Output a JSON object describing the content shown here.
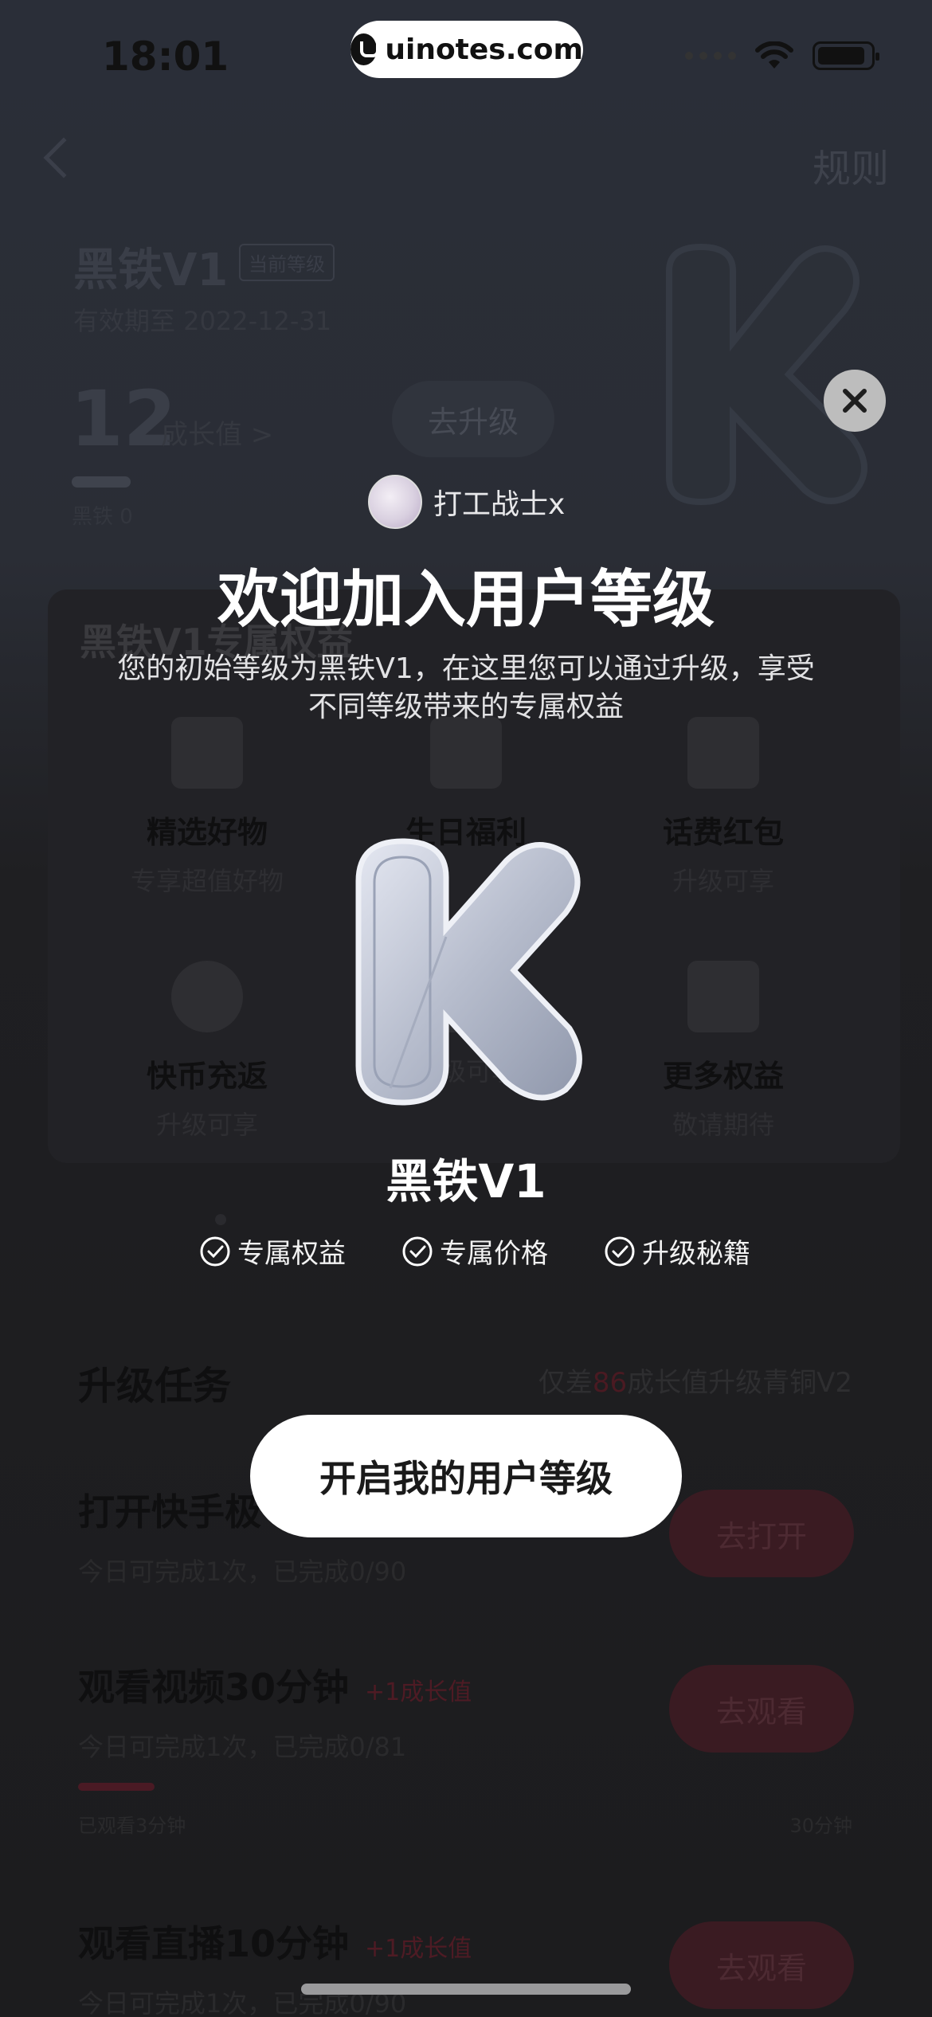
{
  "status_bar": {
    "time": "18:01"
  },
  "watermark": {
    "text": "uinotes.com"
  },
  "header": {
    "rules_label": "规则"
  },
  "level_card": {
    "title": "黑铁V1",
    "current_badge": "当前等级",
    "valid_until": "有效期至 2022-12-31",
    "growth_value": "12",
    "growth_label": "成长值 >",
    "upgrade_button": "去升级",
    "level_label": "黑铁 0"
  },
  "benefits": {
    "title": "黑铁V1专属权益",
    "items": [
      {
        "name": "精选好物",
        "desc": "专享超值好物",
        "icon": "cart-icon"
      },
      {
        "name": "生日福利",
        "desc": "",
        "icon": "cake-icon"
      },
      {
        "name": "话费红包",
        "desc": "升级可享",
        "icon": "phone-icon"
      },
      {
        "name": "快币充返",
        "desc": "升级可享",
        "icon": "coin-icon"
      },
      {
        "name": "",
        "desc": "升级可享",
        "icon": "gift-icon"
      },
      {
        "name": "更多权益",
        "desc": "敬请期待",
        "icon": "grid-icon"
      }
    ]
  },
  "tasks": {
    "title": "升级任务",
    "hint_prefix": "仅差",
    "hint_number": "86",
    "hint_suffix": "成长值升级青铜V2",
    "items": [
      {
        "name": "打开快手极",
        "reward": "",
        "desc": "今日可完成1次，已完成0/90",
        "button": "去打开"
      },
      {
        "name": "观看视频30分钟",
        "reward": "+1成长值",
        "desc": "今日可完成1次，已完成0/81",
        "button": "去观看"
      },
      {
        "name": "观看直播10分钟",
        "reward": "+1成长值",
        "desc": "今日可完成1次，已完成0/90",
        "button": "去观看"
      }
    ],
    "watched_label": "已观看3分钟",
    "duration_label": "30分钟",
    "progress": 0.1
  },
  "modal": {
    "username": "打工战士x",
    "title": "欢迎加入用户等级",
    "subtitle": "您的初始等级为黑铁V1，在这里您可以通过升级，享受不同等级带来的专属权益",
    "level_name": "黑铁V1",
    "perks": [
      "专属权益",
      "专属价格",
      "升级秘籍"
    ],
    "cta": "开启我的用户等级"
  },
  "colors": {
    "overlay": "#16161a",
    "accent_red": "#e6364a",
    "logo_silver": "#b9bfd0",
    "cta_bg": "#ffffff"
  }
}
